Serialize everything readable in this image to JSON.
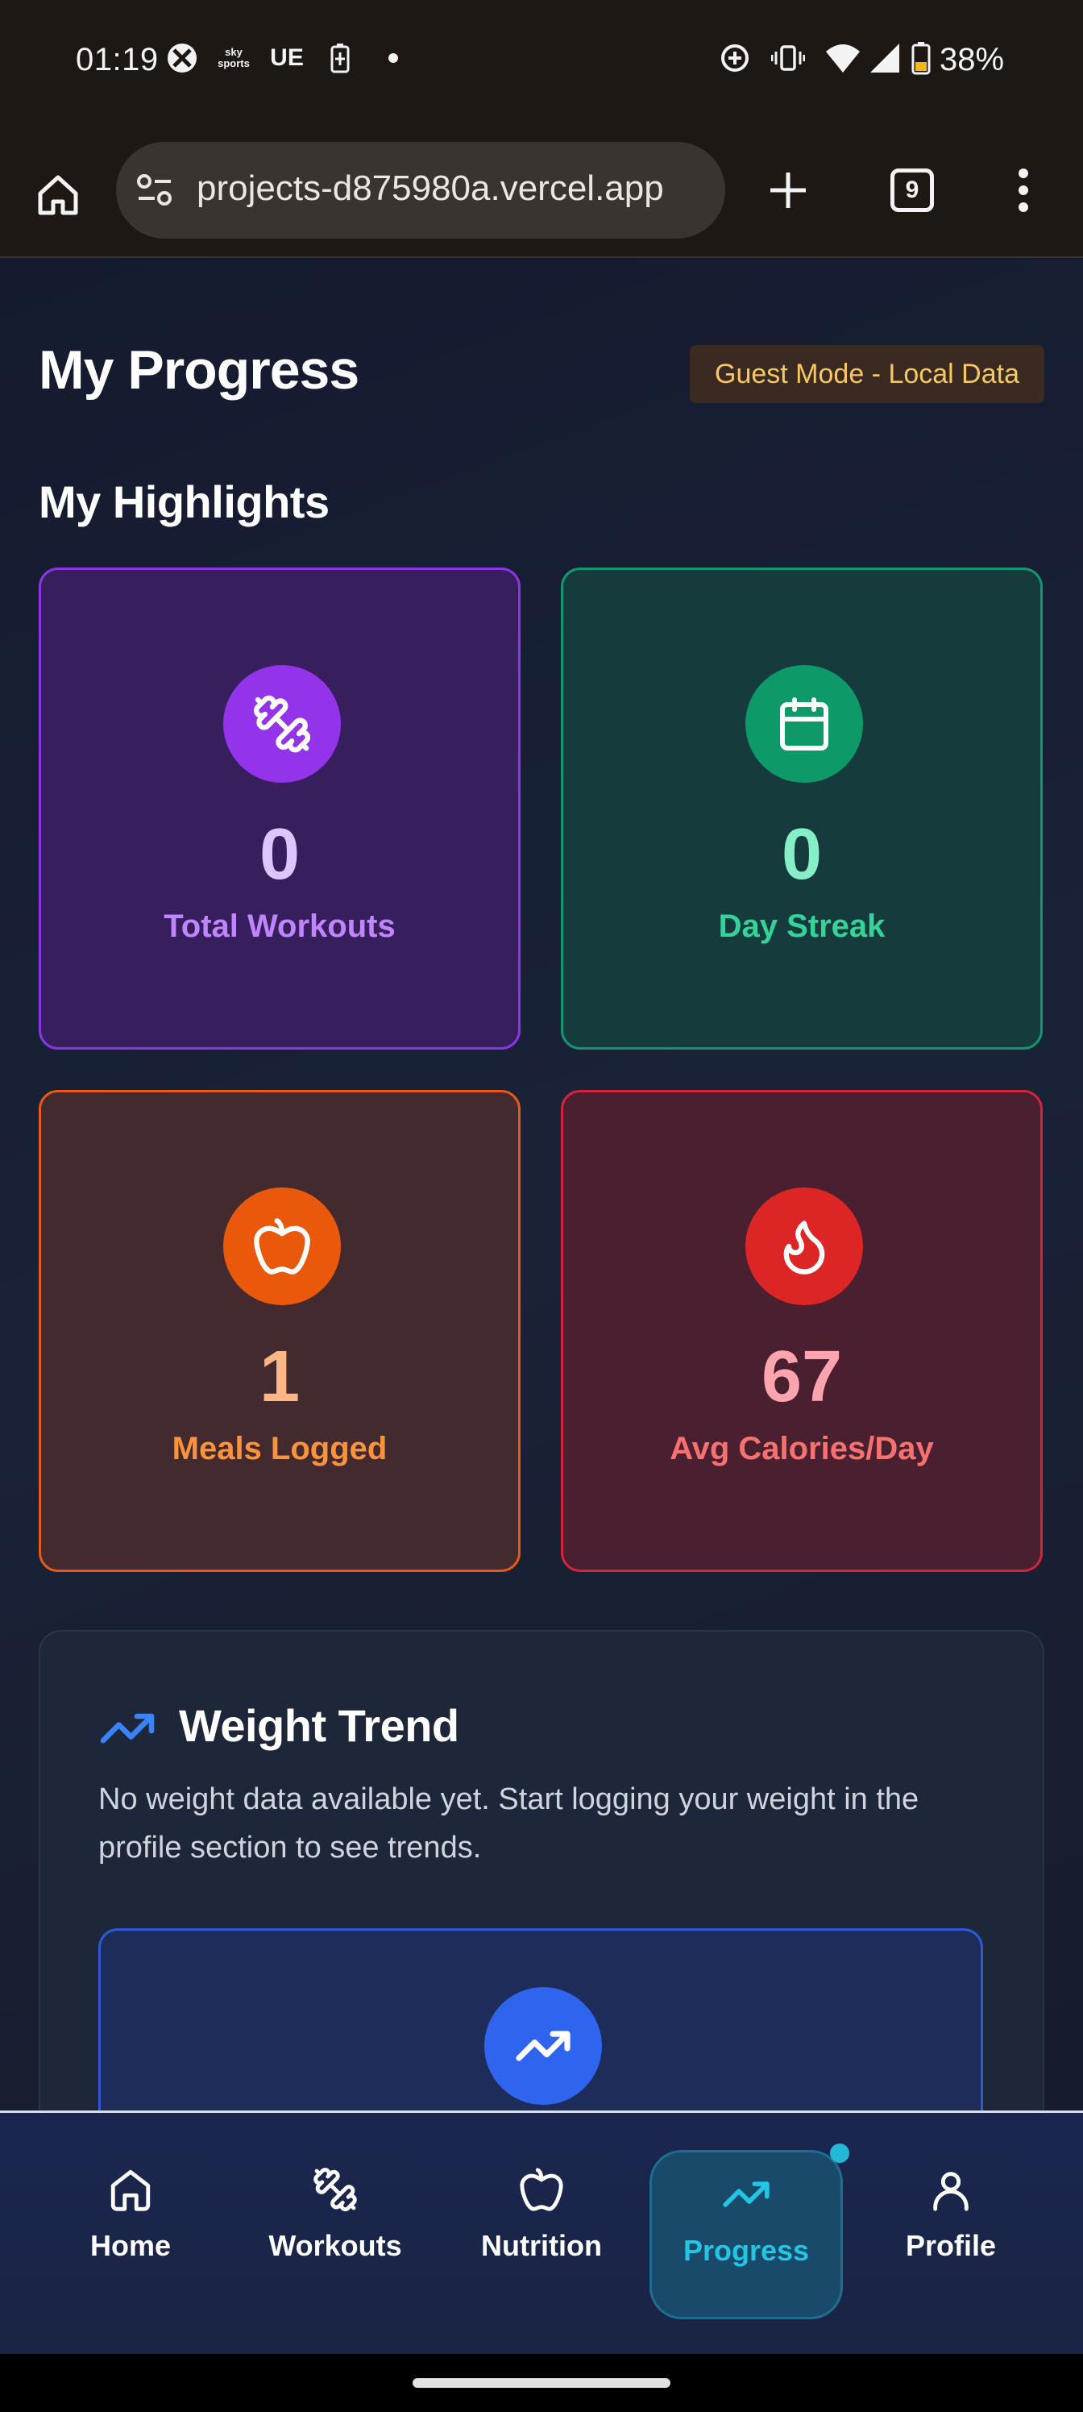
{
  "status_bar": {
    "time": "01:19",
    "carrier_text": "UE",
    "sky_sports": "sky sports",
    "battery_percent": "38%"
  },
  "browser": {
    "url": "projects-d875980a.vercel.app",
    "tab_count": "9"
  },
  "page": {
    "title": "My Progress",
    "guest_badge": "Guest Mode - Local Data",
    "highlights_title": "My Highlights",
    "cards": [
      {
        "value": "0",
        "label": "Total Workouts",
        "icon": "dumbbell-icon",
        "color": "#9333ea"
      },
      {
        "value": "0",
        "label": "Day Streak",
        "icon": "calendar-icon",
        "color": "#0e9a68"
      },
      {
        "value": "1",
        "label": "Meals Logged",
        "icon": "apple-icon",
        "color": "#ea580c"
      },
      {
        "value": "67",
        "label": "Avg Calories/Day",
        "icon": "flame-icon",
        "color": "#dc2626"
      }
    ],
    "weight_trend": {
      "title": "Weight Trend",
      "description": "No weight data available yet. Start logging your weight in the profile section to see trends."
    }
  },
  "bottom_nav": {
    "items": [
      {
        "label": "Home",
        "icon": "home-icon"
      },
      {
        "label": "Workouts",
        "icon": "dumbbell-icon"
      },
      {
        "label": "Nutrition",
        "icon": "apple-icon"
      },
      {
        "label": "Progress",
        "icon": "trending-up-icon"
      },
      {
        "label": "Profile",
        "icon": "user-icon"
      }
    ],
    "active": "Progress"
  }
}
